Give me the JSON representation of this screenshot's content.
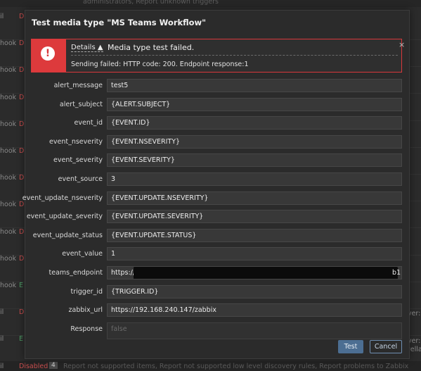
{
  "background": {
    "top_text": "administrators, Report unknown triggers",
    "rows": [
      {
        "kind": "il",
        "status": "D"
      },
      {
        "kind": "hook",
        "status": "D"
      },
      {
        "kind": "hook",
        "status": "D"
      },
      {
        "kind": "hook",
        "status": "D"
      },
      {
        "kind": "hook",
        "status": "D"
      },
      {
        "kind": "hook",
        "status": "D"
      },
      {
        "kind": "hook",
        "status": "D"
      },
      {
        "kind": "hook",
        "status": "D"
      },
      {
        "kind": "hook",
        "status": "D"
      },
      {
        "kind": "hook",
        "status": "D"
      },
      {
        "kind": "hook",
        "status": "E"
      },
      {
        "kind": "il",
        "status": "D"
      },
      {
        "kind": "il",
        "status": "E"
      }
    ],
    "right_fragments": [
      "rver:",
      "rver:",
      "wella"
    ],
    "bottom": {
      "kind": "il",
      "status": "Disabled",
      "badge": "4",
      "actions": "Report not supported items, Report not supported low level discovery rules, Report problems to Zabbix"
    },
    "close_symbol": "×"
  },
  "dialog": {
    "title": "Test media type \"MS Teams Workflow\"",
    "alert": {
      "icon_symbol": "!",
      "details_label": "Details ▲",
      "message": "Media type test failed.",
      "detail": "Sending failed: HTTP code: 200. Endpoint response:1",
      "close_symbol": "×"
    },
    "fields": [
      {
        "label": "alert_message",
        "value": "test5"
      },
      {
        "label": "alert_subject",
        "value": "{ALERT.SUBJECT}"
      },
      {
        "label": "event_id",
        "value": "{EVENT.ID}"
      },
      {
        "label": "event_nseverity",
        "value": "{EVENT.NSEVERITY}"
      },
      {
        "label": "event_severity",
        "value": "{EVENT.SEVERITY}"
      },
      {
        "label": "event_source",
        "value": "3"
      },
      {
        "label": "event_update_nseverity",
        "value": "{EVENT.UPDATE.NSEVERITY}"
      },
      {
        "label": "event_update_severity",
        "value": "{EVENT.UPDATE.SEVERITY}"
      },
      {
        "label": "event_update_status",
        "value": "{EVENT.UPDATE.STATUS}"
      },
      {
        "label": "event_value",
        "value": "1"
      },
      {
        "label": "teams_endpoint",
        "value": "https://",
        "value_tail": "b1"
      },
      {
        "label": "trigger_id",
        "value": "{TRIGGER.ID}"
      },
      {
        "label": "zabbix_url",
        "value": "https://192.168.240.147/zabbix"
      },
      {
        "label": "Response",
        "value": "false"
      }
    ],
    "buttons": {
      "test": "Test",
      "cancel": "Cancel"
    }
  }
}
